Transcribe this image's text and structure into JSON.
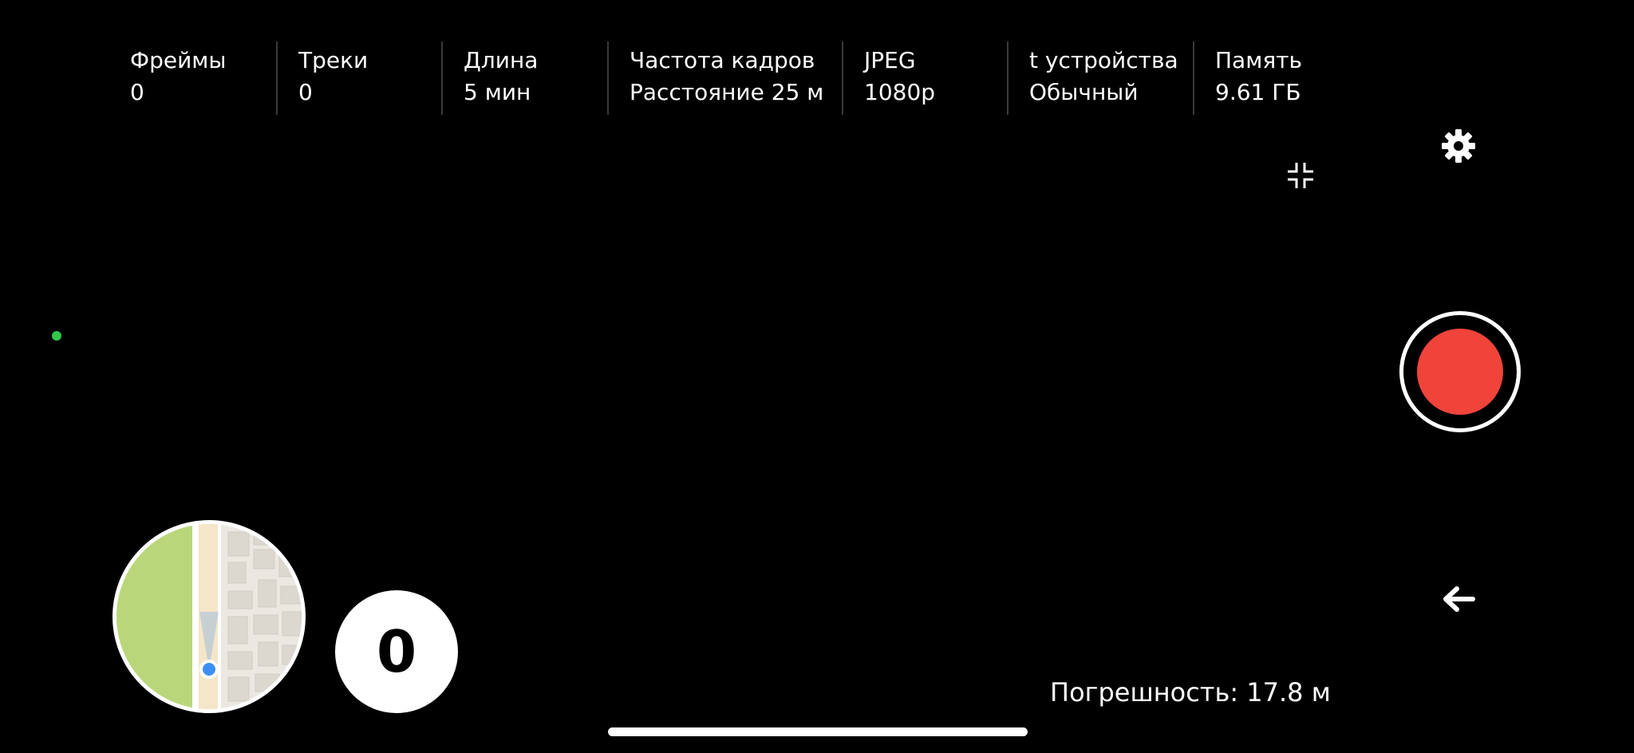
{
  "stats": [
    {
      "label": "Фреймы",
      "value": "0"
    },
    {
      "label": "Треки",
      "value": "0"
    },
    {
      "label": "Длина",
      "value": "5 мин"
    },
    {
      "label": "Частота кадров",
      "value": "Расстояние 25 м"
    },
    {
      "label": "JPEG",
      "value": "1080p"
    },
    {
      "label": "t устройства",
      "value": "Обычный"
    },
    {
      "label": "Память",
      "value": "9.61 ГБ"
    }
  ],
  "counter": {
    "value": "0"
  },
  "accuracy": {
    "label": "Погрешность:",
    "value": "17.8 м"
  },
  "icons": {
    "settings": "gear-icon",
    "fullscreen": "exit-fullscreen-icon",
    "back": "arrow-left-icon",
    "location": "location-dot-icon"
  },
  "colors": {
    "background": "#000000",
    "record": "#f0433a",
    "gps_status": "#2fc84a",
    "map_park": "#b9d77a",
    "map_location": "#3d8ff5"
  }
}
